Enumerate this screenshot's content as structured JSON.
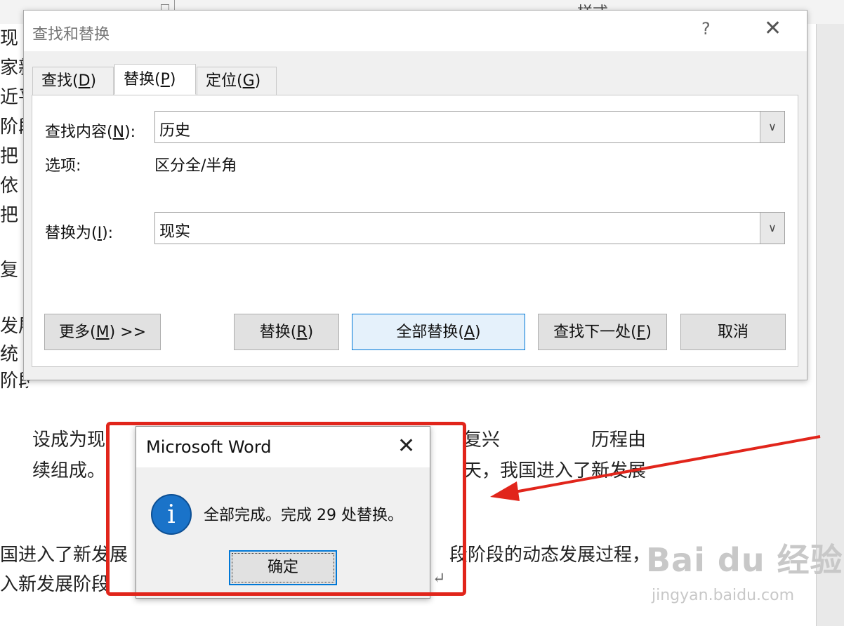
{
  "document": {
    "style_label": "样式",
    "lines_left": [
      "现",
      "家新",
      "近平",
      "阶段",
      "把",
      "依",
      "把",
      "复",
      "发展",
      "统",
      "阶段"
    ],
    "partial_lines": [
      "设成为现",
      "续组成。",
      "国进入了新发展",
      "入新发展阶段"
    ],
    "right_lines": [
      "复兴",
      "历程由",
      "天，我国进入了新发展",
      "段阶段的动态发展过程，"
    ]
  },
  "find_dialog": {
    "title": "查找和替换",
    "help_glyph": "?",
    "close_glyph": "✕",
    "tabs": [
      {
        "pre": "查找(",
        "key": "D",
        "post": ")"
      },
      {
        "pre": "替换(",
        "key": "P",
        "post": ")"
      },
      {
        "pre": "定位(",
        "key": "G",
        "post": ")"
      }
    ],
    "find_label": {
      "pre": "查找内容(",
      "key": "N",
      "post": "):"
    },
    "find_value": "历史",
    "options_label": "选项:",
    "options_value": "区分全/半角",
    "replace_label": {
      "pre": "替换为(",
      "key": "I",
      "post": "):"
    },
    "replace_value": "现实",
    "buttons": {
      "more": {
        "pre": "更多(",
        "key": "M",
        "post": ") >>"
      },
      "replace": {
        "pre": "替换(",
        "key": "R",
        "post": ")"
      },
      "replace_all": {
        "pre": "全部替换(",
        "key": "A",
        "post": ")"
      },
      "find_next": {
        "pre": "查找下一处(",
        "key": "F",
        "post": ")"
      },
      "cancel": "取消"
    }
  },
  "message_box": {
    "title": "Microsoft Word",
    "close_glyph": "✕",
    "icon": "i",
    "text": "全部完成。完成 29 处替换。",
    "ok_label": "确定"
  },
  "watermark": {
    "main": "Bai du 经验",
    "sub": "jingyan.baidu.com"
  },
  "colors": {
    "annotation_red": "#e1251b",
    "accent_blue": "#0078d7"
  }
}
